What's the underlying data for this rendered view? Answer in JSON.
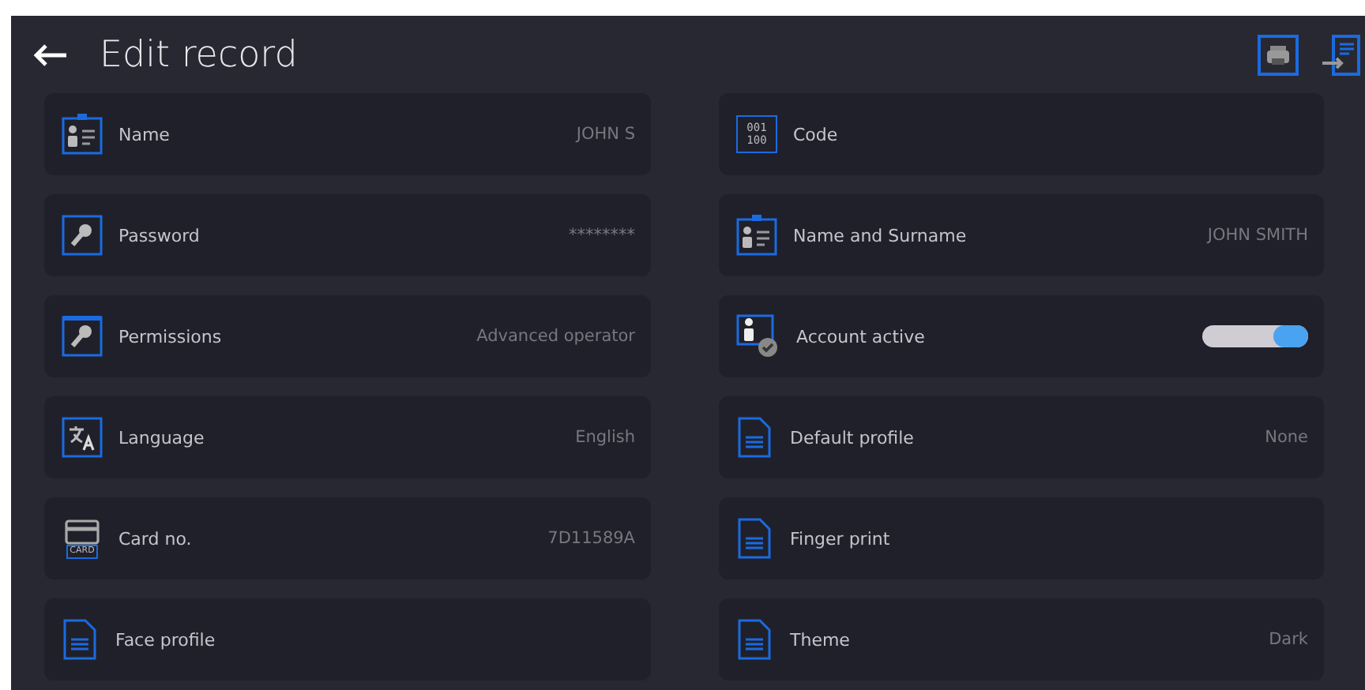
{
  "header": {
    "title": "Edit record"
  },
  "left_items": [
    {
      "label": "Name",
      "value": "JOHN S"
    },
    {
      "label": "Password",
      "value": "********"
    },
    {
      "label": "Permissions",
      "value": "Advanced operator"
    },
    {
      "label": "Language",
      "value": "English"
    },
    {
      "label": "Card no.",
      "value": "7D11589A",
      "icon_text": "CARD"
    },
    {
      "label": "Face profile"
    }
  ],
  "right_items": [
    {
      "label": "Code",
      "icon_text": "001 100"
    },
    {
      "label": "Name and Surname",
      "value": "JOHN SMITH"
    },
    {
      "label": "Account active",
      "kind": "toggle",
      "on": true
    },
    {
      "label": "Default profile",
      "value": "None"
    },
    {
      "label": "Finger print"
    },
    {
      "label": "Theme",
      "value": "Dark"
    }
  ]
}
